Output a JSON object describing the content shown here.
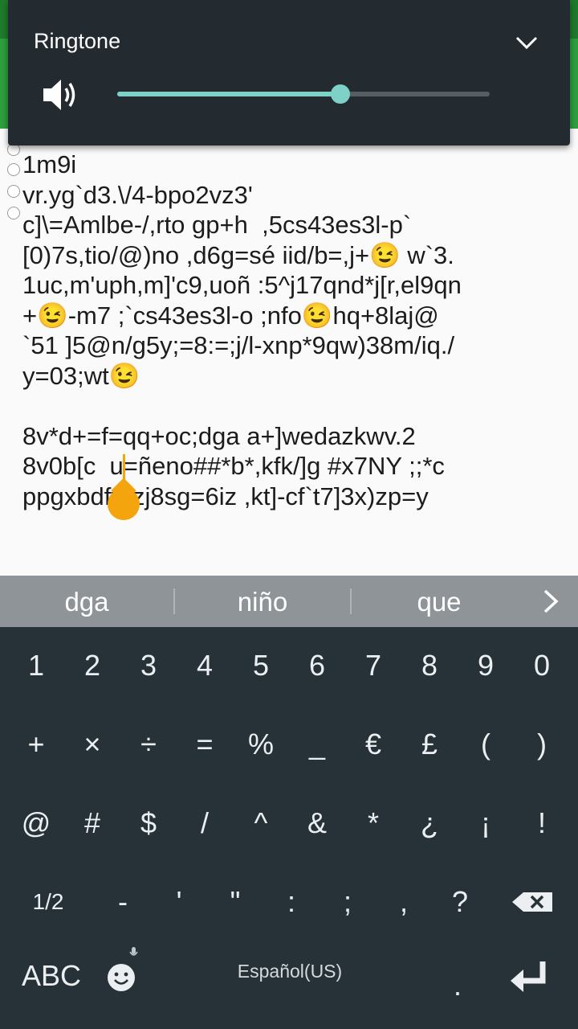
{
  "volume_panel": {
    "title": "Ringtone",
    "level_fraction": 0.6,
    "icons": {
      "speaker": "speaker-icon",
      "collapse": "chevron-down-icon"
    }
  },
  "editor": {
    "text": "1m9i\nvr.yg`d3.\\/4-bpo2vz3'\nc]\\=Amlbe-/,rto gp+h  ,5cs43es3l-p`\n[0)7s,tio/@)no ,d6g=sé iid/b=,j+😉 w`3.\n1uc,m'uph,m]'c9,uoñ :5^j17qnd*j[r,el9qn\n+😉-m7 ;`cs43es3l-o ;nfo😉hq+8laj@\n`51 ]5@n/g5y;=8:=;j/l-xnp*9qw)38m/iq./\ny=03;wt😉\n\n8v*d+=f=qq+oc;dga a+]wedazkwv.2\n8v0b[c  u=ñeno##*b*,kfk/]g #x7NY ;;*c\nppgxbdft=zj8sg=6iz ,kt]-cf`t7]3x)zp=y"
  },
  "suggestions": [
    "dga",
    "niño",
    "que"
  ],
  "keyboard": {
    "rows": [
      [
        "1",
        "2",
        "3",
        "4",
        "5",
        "6",
        "7",
        "8",
        "9",
        "0"
      ],
      [
        "+",
        "×",
        "÷",
        "=",
        "%",
        "_",
        "€",
        "£",
        "(",
        ")"
      ],
      [
        "@",
        "#",
        "$",
        "/",
        "^",
        "&",
        "*",
        "¿",
        "¡",
        "!"
      ],
      [
        "1/2",
        "-",
        "'",
        "\"",
        ":",
        ";",
        ",",
        "?"
      ]
    ],
    "bottom": {
      "abc": "ABC",
      "lang": "Español(US)",
      "period": "."
    },
    "colors": {
      "bg": "#263238",
      "key_text": "#eceff1",
      "accent": "#7ed1c6",
      "cursor": "#f4a40c"
    }
  }
}
